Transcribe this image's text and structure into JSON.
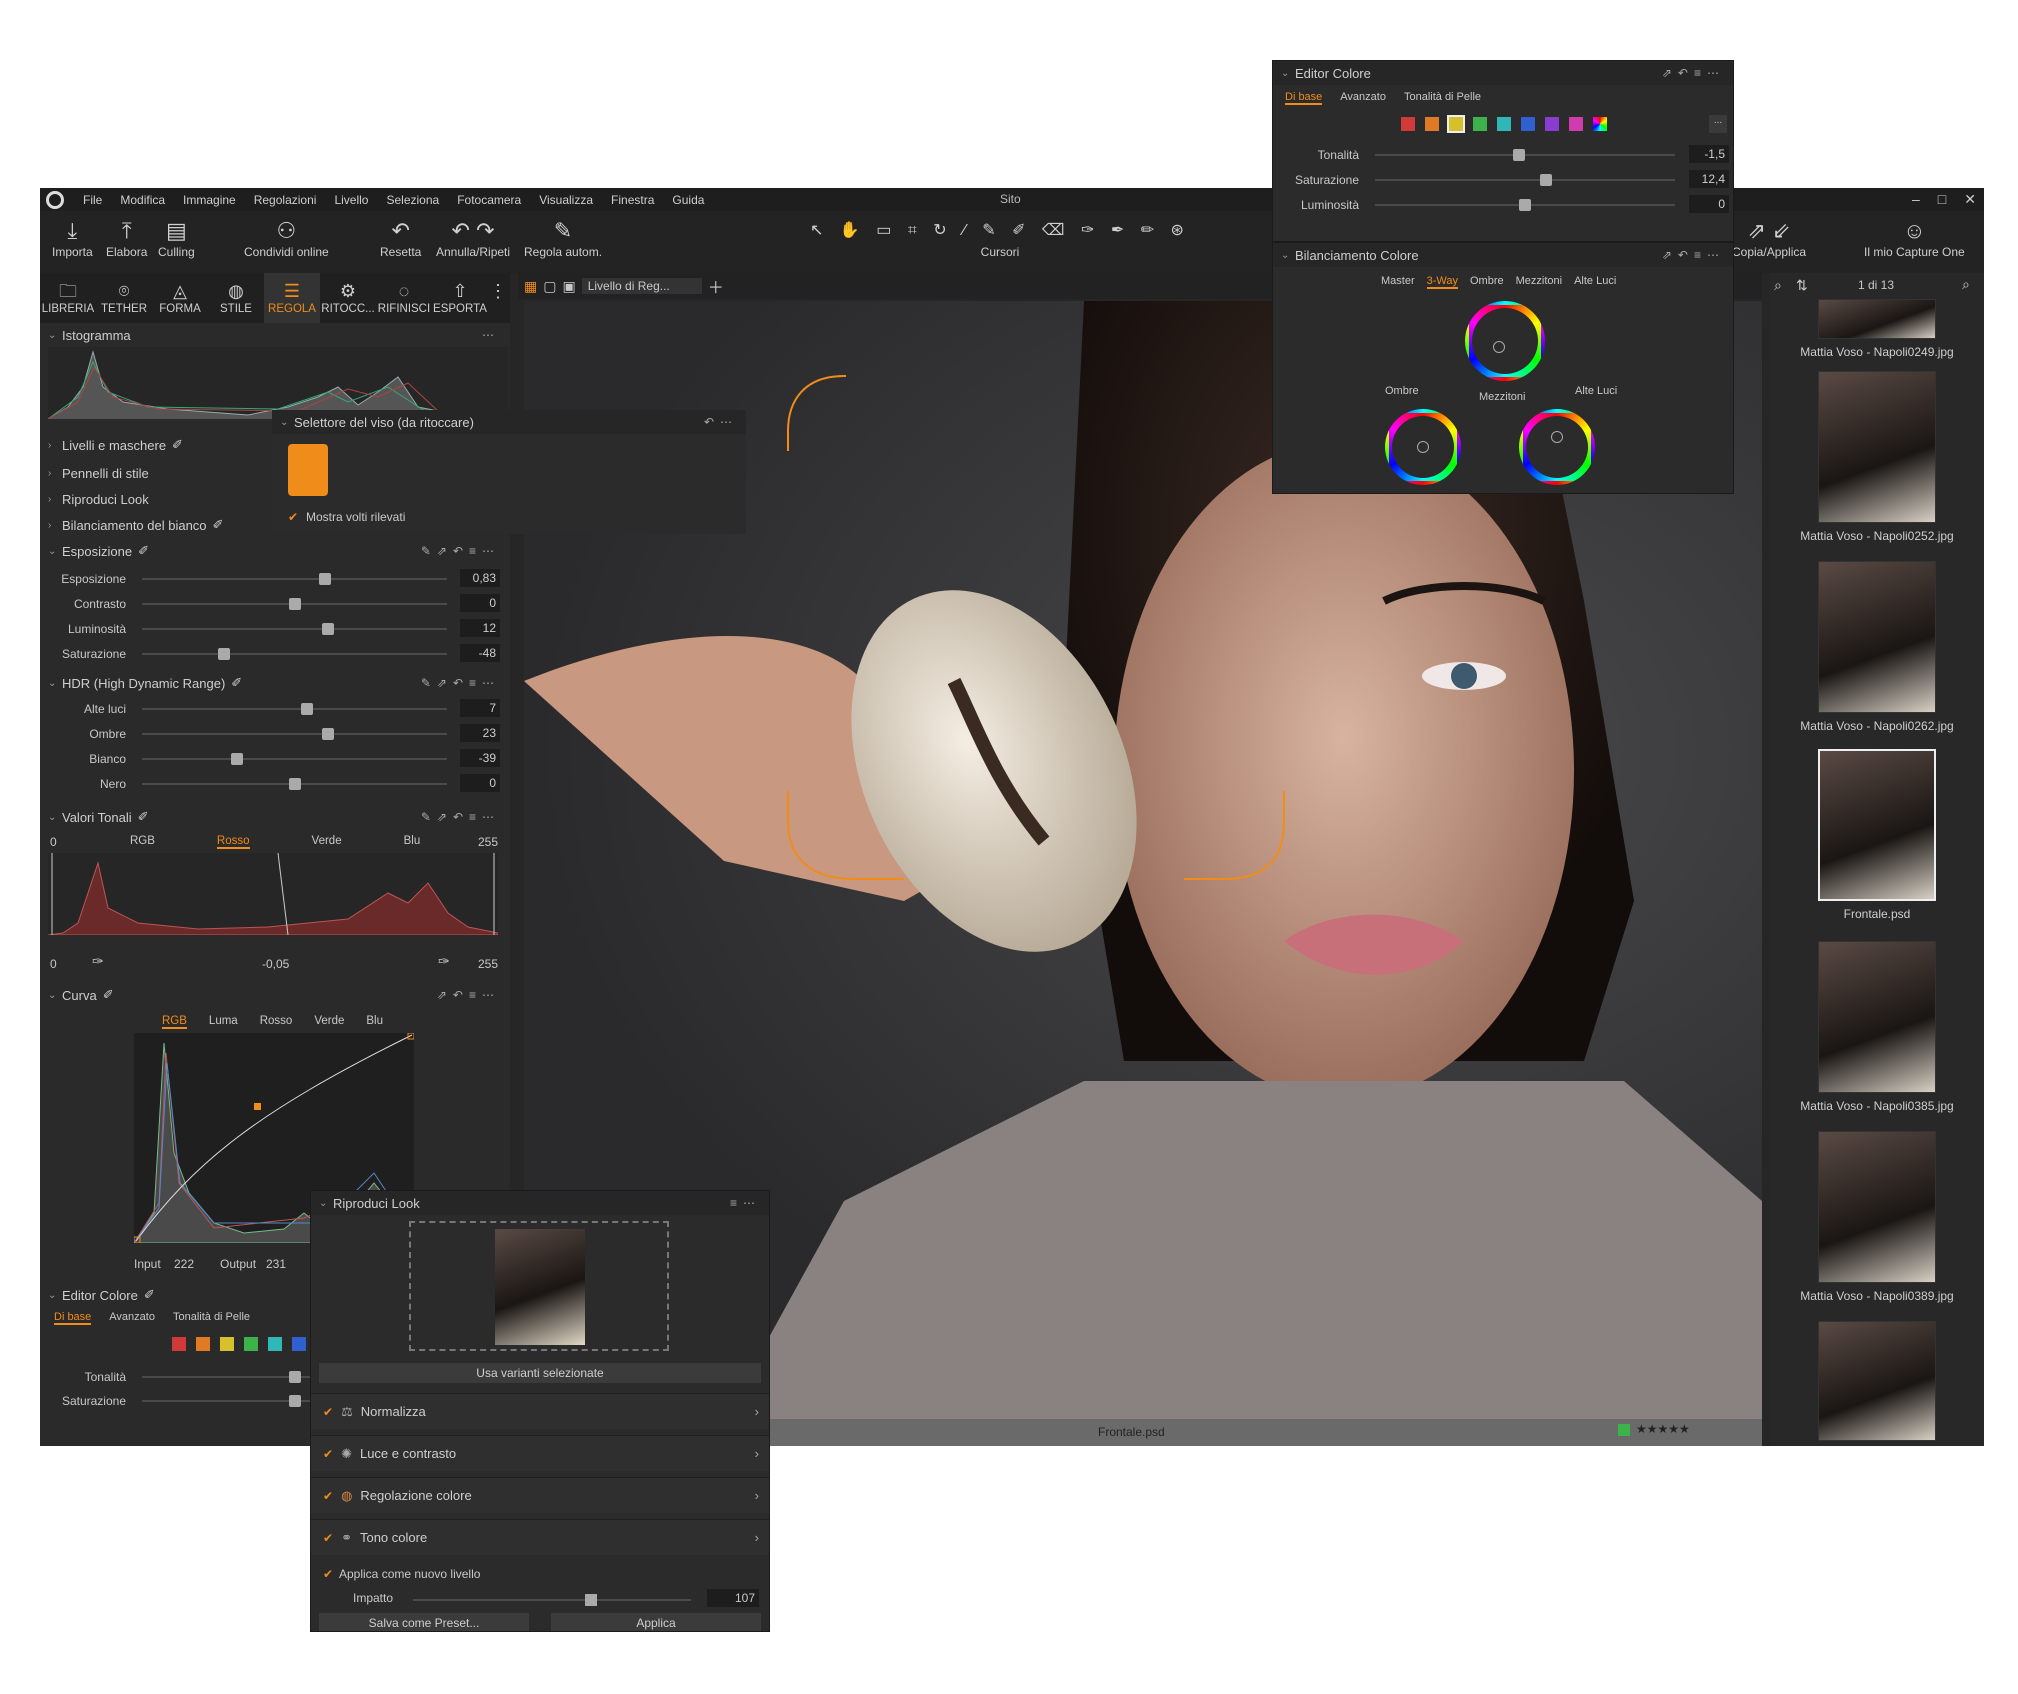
{
  "menu": {
    "items": [
      "File",
      "Modifica",
      "Immagine",
      "Regolazioni",
      "Livello",
      "Seleziona",
      "Fotocamera",
      "Visualizza",
      "Finestra",
      "Guida"
    ],
    "site": "Sito",
    "window": [
      "–",
      "□",
      "✕"
    ]
  },
  "toolbar": {
    "importa": "Importa",
    "elabora": "Elabora",
    "culling": "Culling",
    "condividi": "Condividi online",
    "resetta": "Resetta",
    "annulla": "Annulla/Ripeti",
    "regola": "Regola autom.",
    "cursori": "Cursori",
    "copia": "Copia/Applica",
    "capture": "Il mio Capture One"
  },
  "tooltabs": [
    {
      "label": "LIBRERIA",
      "icon": "folder-icon"
    },
    {
      "label": "TETHER",
      "icon": "camera-icon"
    },
    {
      "label": "FORMA",
      "icon": "shape-icon"
    },
    {
      "label": "STILE",
      "icon": "style-icon"
    },
    {
      "label": "REGOLA",
      "icon": "adjust-icon"
    },
    {
      "label": "RITOCC...",
      "icon": "retouch-icon"
    },
    {
      "label": "RIFINISCI",
      "icon": "refine-icon"
    },
    {
      "label": "ESPORTA",
      "icon": "export-icon"
    }
  ],
  "panels": {
    "istogramma": "Istogramma",
    "livelli": "Livelli e maschere",
    "pennelli": "Pennelli di stile",
    "riproduci": "Riproduci Look",
    "bilanciamento": "Bilanciamento del bianco",
    "esposizione": {
      "title": "Esposizione",
      "rows": [
        {
          "label": "Esposizione",
          "value": "0,83",
          "pos": 0.6
        },
        {
          "label": "Contrasto",
          "value": "0",
          "pos": 0.5
        },
        {
          "label": "Luminosità",
          "value": "12",
          "pos": 0.61
        },
        {
          "label": "Saturazione",
          "value": "-48",
          "pos": 0.27
        }
      ]
    },
    "hdr": {
      "title": "HDR (High Dynamic Range)",
      "rows": [
        {
          "label": "Alte luci",
          "value": "7",
          "pos": 0.54
        },
        {
          "label": "Ombre",
          "value": "23",
          "pos": 0.61
        },
        {
          "label": "Bianco",
          "value": "-39",
          "pos": 0.31
        },
        {
          "label": "Nero",
          "value": "0",
          "pos": 0.5
        }
      ]
    },
    "valori": {
      "title": "Valori Tonali",
      "tabs": [
        "RGB",
        "Rosso",
        "Verde",
        "Blu"
      ],
      "active": "Rosso",
      "min": "0",
      "max": "255",
      "mid": "-0,05",
      "bottomMin": "0",
      "bottomMax": "255"
    },
    "curva": {
      "title": "Curva",
      "tabs": [
        "RGB",
        "Luma",
        "Rosso",
        "Verde",
        "Blu"
      ],
      "active": "RGB",
      "input_label": "Input",
      "input": "222",
      "output_label": "Output",
      "output": "231"
    },
    "editor": {
      "title": "Editor Colore",
      "tabs": [
        "Di base",
        "Avanzato",
        "Tonalità di Pelle"
      ],
      "tonalita": "Tonalità",
      "saturazione": "Saturazione"
    }
  },
  "face": {
    "title": "Selettore del viso (da ritoccare)",
    "checkbox": "Mostra volti rilevati"
  },
  "viewer": {
    "layer": "Livello di Reg...",
    "filename": "Frontale.psd",
    "stars": "★★★★★"
  },
  "browser": {
    "count": "1 di 13",
    "items": [
      {
        "name": "Mattia Voso - Napoli0249.jpg"
      },
      {
        "name": "Mattia Voso - Napoli0252.jpg"
      },
      {
        "name": "Mattia Voso - Napoli0262.jpg"
      },
      {
        "name": "Frontale.psd"
      },
      {
        "name": "Mattia Voso - Napoli0385.jpg"
      },
      {
        "name": "Mattia Voso - Napoli0389.jpg"
      },
      {
        "name": ""
      }
    ]
  },
  "editorFloat": {
    "title": "Editor Colore",
    "tabs": [
      "Di base",
      "Avanzato",
      "Tonalità di Pelle"
    ],
    "more": "...",
    "rows": [
      {
        "label": "Tonalità",
        "value": "-1,5",
        "pos": 0.48
      },
      {
        "label": "Saturazione",
        "value": "12,4",
        "pos": 0.57
      },
      {
        "label": "Luminosità",
        "value": "0",
        "pos": 0.5
      }
    ]
  },
  "balanceFloat": {
    "title": "Bilanciamento Colore",
    "tabs": [
      "Master",
      "3-Way",
      "Ombre",
      "Mezzitoni",
      "Alte Luci"
    ],
    "active": "3-Way",
    "ombre": "Ombre",
    "mezzitoni": "Mezzitoni",
    "alteluci": "Alte Luci"
  },
  "lookFloat": {
    "title": "Riproduci Look",
    "use": "Usa varianti selezionate",
    "rows": [
      "Normalizza",
      "Luce e contrasto",
      "Regolazione colore",
      "Tono colore"
    ],
    "apply_layer": "Applica come nuovo livello",
    "impatto": "Impatto",
    "impatto_value": "107",
    "save": "Salva come Preset...",
    "apply": "Applica"
  },
  "colors": {
    "accent": "#f08c1a",
    "bg": "#262626"
  }
}
